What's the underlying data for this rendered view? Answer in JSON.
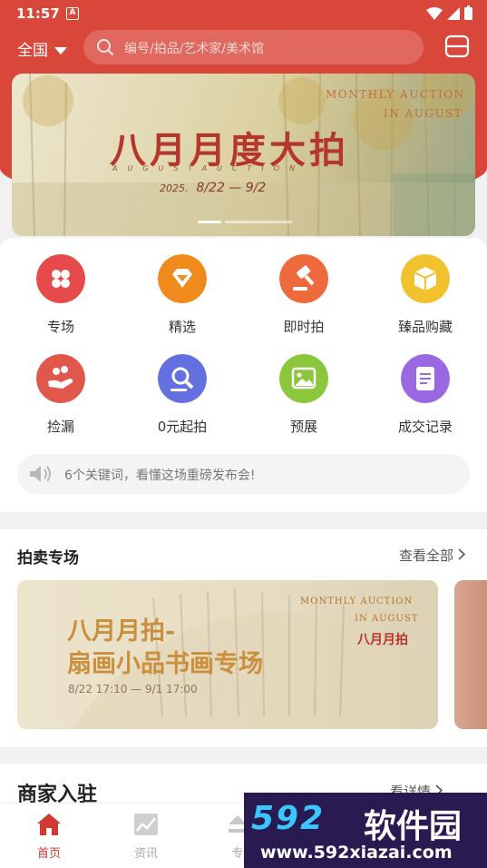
{
  "status": {
    "time": "11:57",
    "indicator": "A"
  },
  "search": {
    "region": "全国",
    "placeholder": "编号/拍品/艺术家/美术馆"
  },
  "banner": {
    "title": "八月月度大拍",
    "subtitle": "AUGUSTAUCTION",
    "year": "2025.",
    "dates": "8/22  — 9/2",
    "monthly_1": "MONTHLY AUCTION",
    "monthly_2": "IN AUGUST"
  },
  "categories": [
    {
      "label": "专场",
      "color": "#e64a4a",
      "icon": "four-petal-icon"
    },
    {
      "label": "精选",
      "color": "#f08a1c",
      "icon": "diamond-icon"
    },
    {
      "label": "即时拍",
      "color": "#ee6a3c",
      "icon": "gavel-icon"
    },
    {
      "label": "臻品购藏",
      "color": "#f2c12e",
      "icon": "box-icon"
    },
    {
      "label": "捡漏",
      "color": "#e0574c",
      "icon": "hand-coins-icon"
    },
    {
      "label": "0元起拍",
      "color": "#6470e0",
      "icon": "auction-hammer-icon"
    },
    {
      "label": "预展",
      "color": "#8cc63c",
      "icon": "picture-icon"
    },
    {
      "label": "成交记录",
      "color": "#9a68e0",
      "icon": "document-icon"
    }
  ],
  "notice": {
    "text": "6个关键词，看懂这场重磅发布会!"
  },
  "auction_section": {
    "title": "拍卖专场",
    "more": "查看全部",
    "card": {
      "title_line1": "八月月拍-",
      "title_line2": "扇画小品书画专场",
      "date": "8/22 17:10 — 9/1 17:00",
      "monthly_1": "MONTHLY AUCTION",
      "monthly_2": "IN AUGUST",
      "tag": "八月月拍"
    }
  },
  "merchant_section": {
    "title": "商家入驻",
    "more": "看详情"
  },
  "tabs": [
    {
      "label": "首页",
      "active": true,
      "icon": "home-icon"
    },
    {
      "label": "资讯",
      "active": false,
      "icon": "chart-icon"
    },
    {
      "label": "专",
      "active": false,
      "icon": "upload-icon"
    }
  ],
  "watermark": {
    "brand_num": "592",
    "brand_cn": "软件园",
    "url": "www.592xiazai.com"
  },
  "colors": {
    "primary": "#d9473b",
    "active_tab": "#d23a30",
    "inactive_tab": "#aaaaaa"
  }
}
